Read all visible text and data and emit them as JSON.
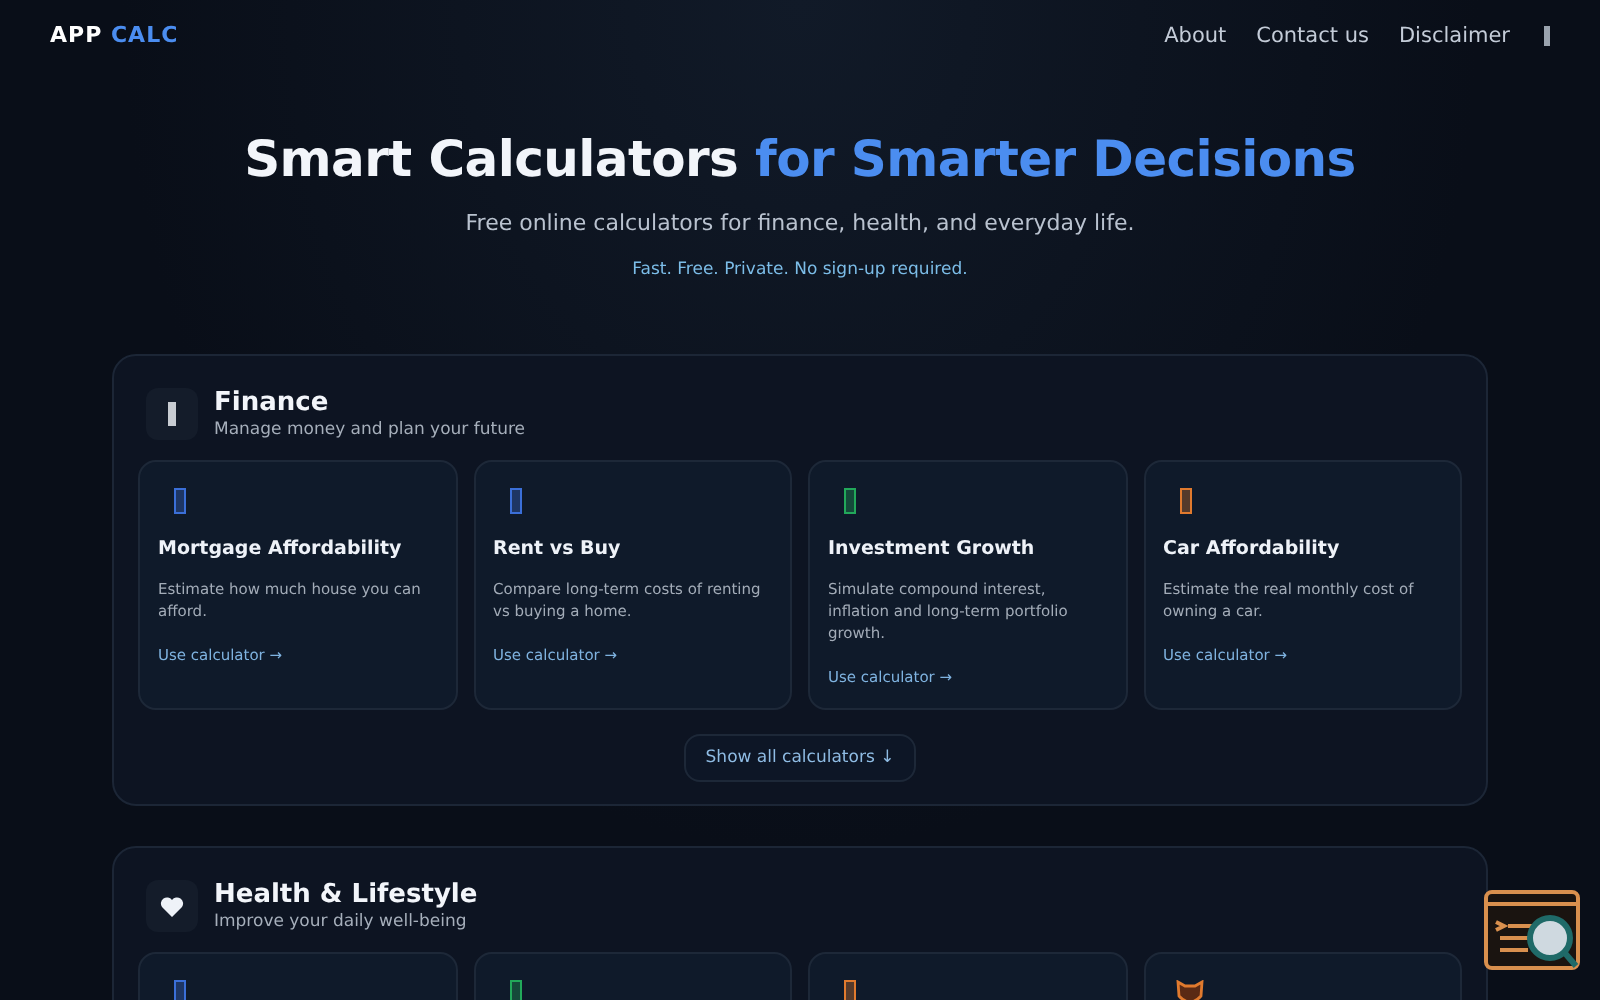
{
  "brand": {
    "first": "APP",
    "second": "CALC"
  },
  "nav": [
    "About",
    "Contact us",
    "Disclaimer"
  ],
  "hero": {
    "title": "Smart Calculators",
    "title_accent": "for Smarter Decisions",
    "subtitle": "Free online calculators for finance, health, and everyday life.",
    "tagline": "Fast. Free. Private. No sign-up required."
  },
  "sections": [
    {
      "kind": "bar",
      "title": "Finance",
      "subtitle": "Manage money and plan your future",
      "show_all": "Show all calculators ↓",
      "cards": [
        {
          "kind": "bar",
          "color": "#3b6fd8",
          "title": "Mortgage Affordability",
          "description": "Estimate how much house you can afford.",
          "link": "Use calculator →"
        },
        {
          "kind": "bar",
          "color": "#3b6fd8",
          "title": "Rent vs Buy",
          "description": "Compare long-term costs of renting vs buying a home.",
          "link": "Use calculator →"
        },
        {
          "kind": "bar",
          "color": "#22a85a",
          "title": "Investment Growth",
          "description": "Simulate compound interest, inflation and long-term portfolio growth.",
          "link": "Use calculator →"
        },
        {
          "kind": "bar",
          "color": "#e07a2e",
          "title": "Car Affordability",
          "description": "Estimate the real monthly cost of owning a car.",
          "link": "Use calculator →"
        }
      ]
    },
    {
      "kind": "heart",
      "title": "Health & Lifestyle",
      "subtitle": "Improve your daily well-being",
      "cards": [
        {
          "kind": "bar",
          "color": "#3b6fd8"
        },
        {
          "kind": "bar",
          "color": "#22a85a"
        },
        {
          "kind": "bar",
          "color": "#e07a2e"
        },
        {
          "kind": "animal",
          "color": "#e07a2e"
        }
      ]
    }
  ]
}
